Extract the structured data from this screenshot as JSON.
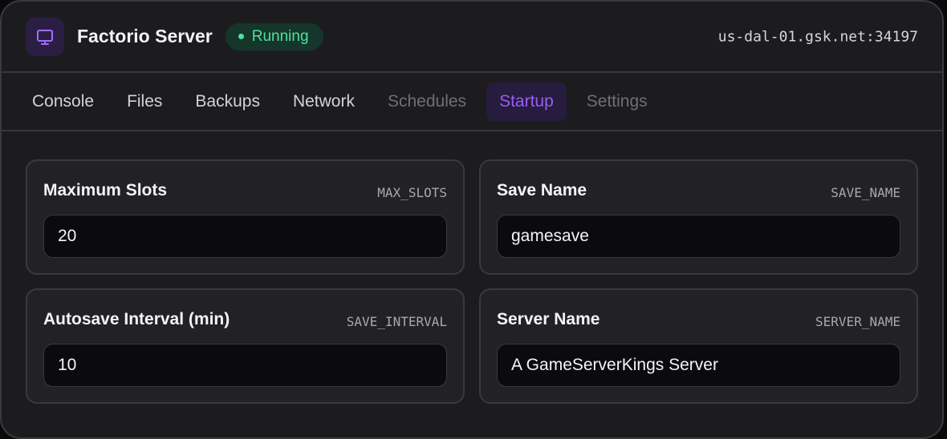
{
  "header": {
    "app_icon": "monitor-icon",
    "title": "Factorio Server",
    "status": "Running",
    "address": "us-dal-01.gsk.net:34197"
  },
  "tabs": [
    {
      "label": "Console",
      "state": "normal"
    },
    {
      "label": "Files",
      "state": "normal"
    },
    {
      "label": "Backups",
      "state": "normal"
    },
    {
      "label": "Network",
      "state": "normal"
    },
    {
      "label": "Schedules",
      "state": "dim"
    },
    {
      "label": "Startup",
      "state": "active"
    },
    {
      "label": "Settings",
      "state": "dim"
    }
  ],
  "variables": [
    {
      "label": "Maximum Slots",
      "var": "MAX_SLOTS",
      "value": "20"
    },
    {
      "label": "Save Name",
      "var": "SAVE_NAME",
      "value": "gamesave"
    },
    {
      "label": "Autosave Interval (min)",
      "var": "SAVE_INTERVAL",
      "value": "10"
    },
    {
      "label": "Server Name",
      "var": "SERVER_NAME",
      "value": "A GameServerKings Server"
    }
  ],
  "colors": {
    "accent": "#9b5cf6",
    "status_green": "#4ee0a2",
    "background": "#1c1c1f"
  }
}
